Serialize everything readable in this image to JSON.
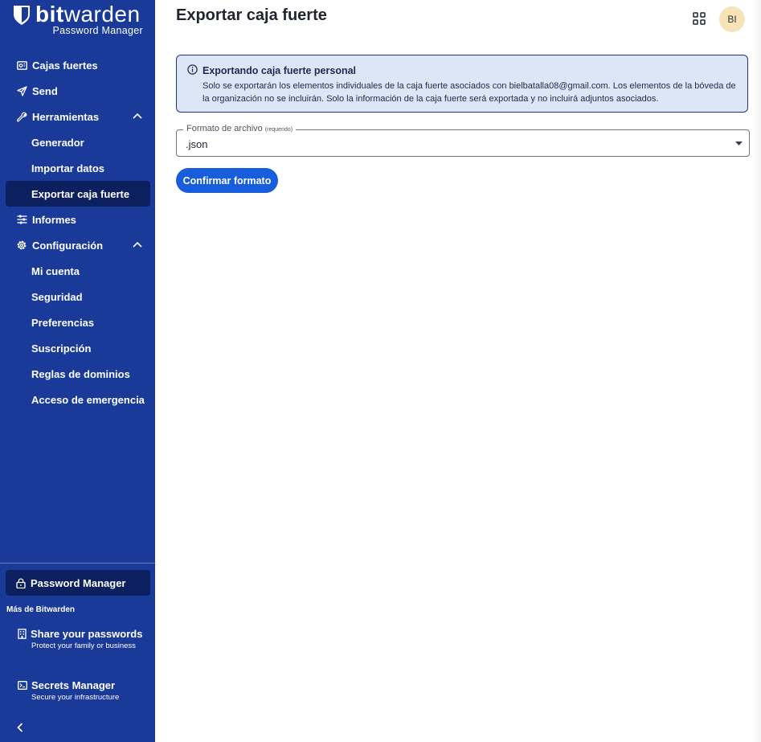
{
  "brand": {
    "name_bold": "bit",
    "name_regular": "warden",
    "product": "Password Manager"
  },
  "nav": {
    "items": [
      {
        "label": "Cajas fuertes"
      },
      {
        "label": "Send"
      },
      {
        "label": "Herramientas"
      },
      {
        "label": "Generador"
      },
      {
        "label": "Importar datos"
      },
      {
        "label": "Exportar caja fuerte"
      },
      {
        "label": "Informes"
      },
      {
        "label": "Configuración"
      },
      {
        "label": "Mi cuenta"
      },
      {
        "label": "Seguridad"
      },
      {
        "label": "Preferencias"
      },
      {
        "label": "Suscripción"
      },
      {
        "label": "Reglas de dominios"
      },
      {
        "label": "Acceso de emergencia"
      }
    ]
  },
  "bottom": {
    "current_product": "Password Manager",
    "more_label": "Más de Bitwarden",
    "products": [
      {
        "title": "Share your passwords",
        "desc": "Protect your family or business"
      },
      {
        "title": "Secrets Manager",
        "desc": "Secure your infrastructure"
      }
    ]
  },
  "header": {
    "title": "Exportar caja fuerte",
    "avatar_initials": "BI"
  },
  "callout": {
    "title": "Exportando caja fuerte personal",
    "text": "Solo se exportarán los elementos individuales de la caja fuerte asociados con bielbatalla08@gmail.com. Los elementos de la bóveda de la organización no se incluirán. Solo la información de la caja fuerte será exportada y no incluirá adjuntos asociados."
  },
  "form": {
    "format_label": "Formato de archivo",
    "required_label": "(requerido)",
    "format_value": ".json",
    "confirm_label": "Confirmar formato"
  },
  "colors": {
    "sidebar": "#193a99",
    "active": "#0c1f5e",
    "primary": "#175ddc",
    "callout_bg": "#dde6f6",
    "avatar_bg": "#f6e4b8"
  }
}
